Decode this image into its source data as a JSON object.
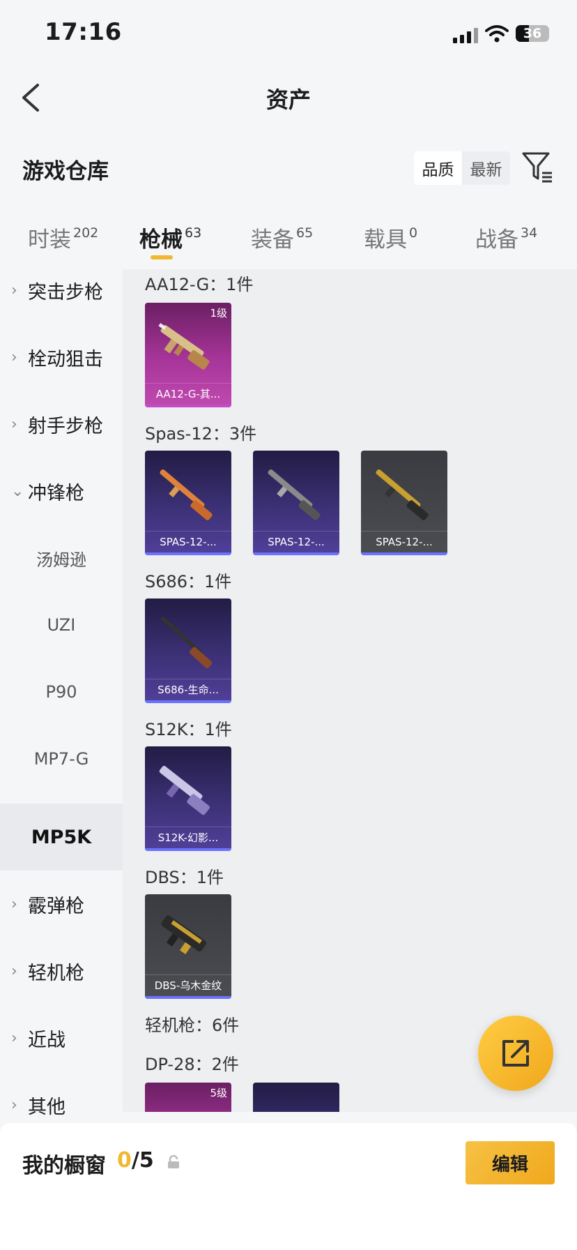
{
  "status": {
    "time": "17:16",
    "battery": "36"
  },
  "header": {
    "title": "资产"
  },
  "warehouse": {
    "title": "游戏仓库",
    "sort_quality": "品质",
    "sort_latest": "最新"
  },
  "tabs": [
    {
      "label": "时装",
      "count": "202"
    },
    {
      "label": "枪械",
      "count": "63"
    },
    {
      "label": "装备",
      "count": "65"
    },
    {
      "label": "载具",
      "count": "0"
    },
    {
      "label": "战备",
      "count": "34"
    }
  ],
  "sidebar": [
    {
      "label": "突击步枪"
    },
    {
      "label": "栓动狙击"
    },
    {
      "label": "射手步枪"
    },
    {
      "label": "冲锋枪"
    },
    {
      "label": "汤姆逊"
    },
    {
      "label": "UZI"
    },
    {
      "label": "P90"
    },
    {
      "label": "MP7-G"
    },
    {
      "label": "MP5K"
    },
    {
      "label": "霰弹枪"
    },
    {
      "label": "轻机枪"
    },
    {
      "label": "近战"
    },
    {
      "label": "其他"
    }
  ],
  "sections": [
    {
      "title": "AA12-G：1件",
      "items": [
        {
          "name": "AA12-G-其...",
          "level": "1级"
        }
      ]
    },
    {
      "title": "Spas-12：3件",
      "items": [
        {
          "name": "SPAS-12-..."
        },
        {
          "name": "SPAS-12-..."
        },
        {
          "name": "SPAS-12-..."
        }
      ]
    },
    {
      "title": "S686：1件",
      "items": [
        {
          "name": "S686-生命..."
        }
      ]
    },
    {
      "title": "S12K：1件",
      "items": [
        {
          "name": "S12K-幻影..."
        }
      ]
    },
    {
      "title": "DBS：1件",
      "items": [
        {
          "name": "DBS-乌木金纹"
        }
      ]
    },
    {
      "title": "轻机枪：6件"
    },
    {
      "title": "DP-28：2件",
      "items": [
        {
          "level": "5级"
        }
      ]
    }
  ],
  "showcase": {
    "label": "我的橱窗",
    "current": "0",
    "total": "/5",
    "edit": "编辑"
  },
  "colors": {
    "accent": "#f0b830",
    "purple_card": "#a8359a",
    "blue_card": "#3a2f72",
    "gray_card": "#4c4d52"
  }
}
